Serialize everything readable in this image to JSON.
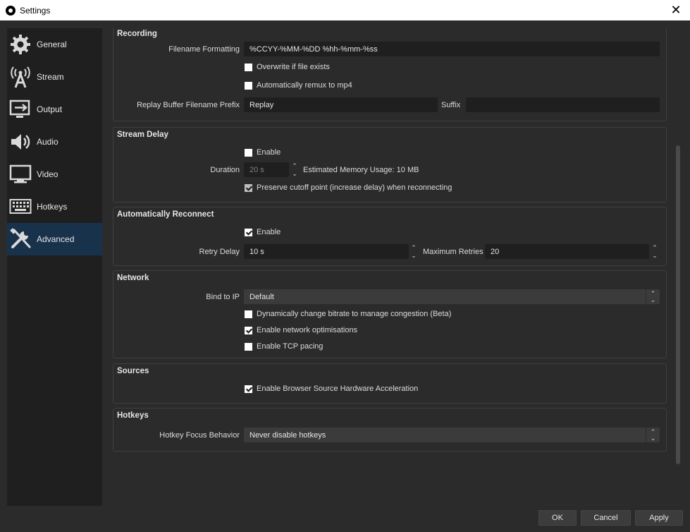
{
  "window": {
    "title": "Settings",
    "close_glyph": "✕"
  },
  "sidebar": {
    "items": [
      {
        "label": "General",
        "icon": "gear-icon"
      },
      {
        "label": "Stream",
        "icon": "broadcast-icon"
      },
      {
        "label": "Output",
        "icon": "output-icon"
      },
      {
        "label": "Audio",
        "icon": "speaker-icon"
      },
      {
        "label": "Video",
        "icon": "monitor-icon"
      },
      {
        "label": "Hotkeys",
        "icon": "keyboard-icon"
      },
      {
        "label": "Advanced",
        "icon": "tools-icon",
        "active": true
      }
    ]
  },
  "recording": {
    "title": "Recording",
    "filename_label": "Filename Formatting",
    "filename_value": "%CCYY-%MM-%DD %hh-%mm-%ss",
    "overwrite_label": "Overwrite if file exists",
    "overwrite_checked": false,
    "remux_label": "Automatically remux to mp4",
    "remux_checked": false,
    "replay_prefix_label": "Replay Buffer Filename Prefix",
    "replay_prefix_value": "Replay",
    "suffix_label": "Suffix",
    "suffix_value": ""
  },
  "stream_delay": {
    "title": "Stream Delay",
    "enable_label": "Enable",
    "enable_checked": false,
    "duration_label": "Duration",
    "duration_value": "20 s",
    "memory_text": "Estimated Memory Usage: 10 MB",
    "preserve_label": "Preserve cutoff point (increase delay) when reconnecting",
    "preserve_checked": true
  },
  "reconnect": {
    "title": "Automatically Reconnect",
    "enable_label": "Enable",
    "enable_checked": true,
    "retry_delay_label": "Retry Delay",
    "retry_delay_value": "10 s",
    "max_retries_label": "Maximum Retries",
    "max_retries_value": "20"
  },
  "network": {
    "title": "Network",
    "bind_label": "Bind to IP",
    "bind_value": "Default",
    "dynamic_bitrate_label": "Dynamically change bitrate to manage congestion (Beta)",
    "dynamic_bitrate_checked": false,
    "optimisations_label": "Enable network optimisations",
    "optimisations_checked": true,
    "tcp_pacing_label": "Enable TCP pacing",
    "tcp_pacing_checked": false
  },
  "sources": {
    "title": "Sources",
    "browser_accel_label": "Enable Browser Source Hardware Acceleration",
    "browser_accel_checked": true
  },
  "hotkeys": {
    "title": "Hotkeys",
    "focus_label": "Hotkey Focus Behavior",
    "focus_value": "Never disable hotkeys"
  },
  "footer": {
    "ok": "OK",
    "cancel": "Cancel",
    "apply": "Apply"
  },
  "glyphs": {
    "up": "⌃",
    "down": "⌄"
  }
}
